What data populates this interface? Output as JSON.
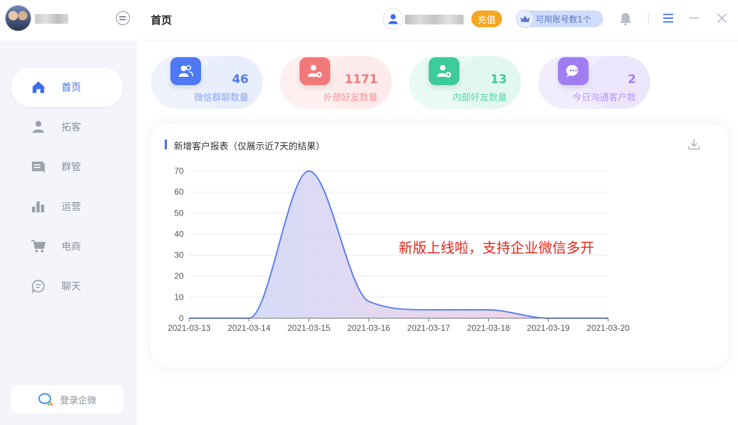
{
  "sidebar": {
    "nav": [
      {
        "label": "首页",
        "icon": "home-icon"
      },
      {
        "label": "拓客",
        "icon": "person-icon"
      },
      {
        "label": "群管",
        "icon": "group-manage-icon"
      },
      {
        "label": "运营",
        "icon": "bar-chart-icon"
      },
      {
        "label": "电商",
        "icon": "shopping-cart-icon"
      },
      {
        "label": "聊天",
        "icon": "chat-icon"
      }
    ],
    "login_label": "登录企微"
  },
  "header": {
    "page_title": "首页",
    "recharge_label": "充值",
    "accounts_label": "可用账号数1个"
  },
  "stats": [
    {
      "value": "46",
      "label": "微信群聊数量",
      "color": "#4f79f3"
    },
    {
      "value": "1171",
      "label": "外部好友数量",
      "color": "#f2797a"
    },
    {
      "value": "13",
      "label": "内部好友数量",
      "color": "#3ecb9c"
    },
    {
      "value": "2",
      "label": "今日沟通客户数",
      "color": "#a07ef2"
    }
  ],
  "panel": {
    "title": "新增客户报表（仅展示近7天的结果）",
    "promo": "新版上线啦，支持企业微信多开"
  },
  "chart_data": {
    "type": "area",
    "x": [
      "2021-03-13",
      "2021-03-14",
      "2021-03-15",
      "2021-03-16",
      "2021-03-17",
      "2021-03-18",
      "2021-03-19",
      "2021-03-20"
    ],
    "y": [
      0,
      0,
      70,
      8,
      4,
      4,
      0,
      0
    ],
    "ylim": [
      0,
      70
    ],
    "yticks": [
      0,
      10,
      20,
      30,
      40,
      50,
      60,
      70
    ],
    "grid": true,
    "line_color": "#5b7ff0",
    "fill_gradient": [
      "#c9d6fb",
      "#f6cde0"
    ]
  }
}
